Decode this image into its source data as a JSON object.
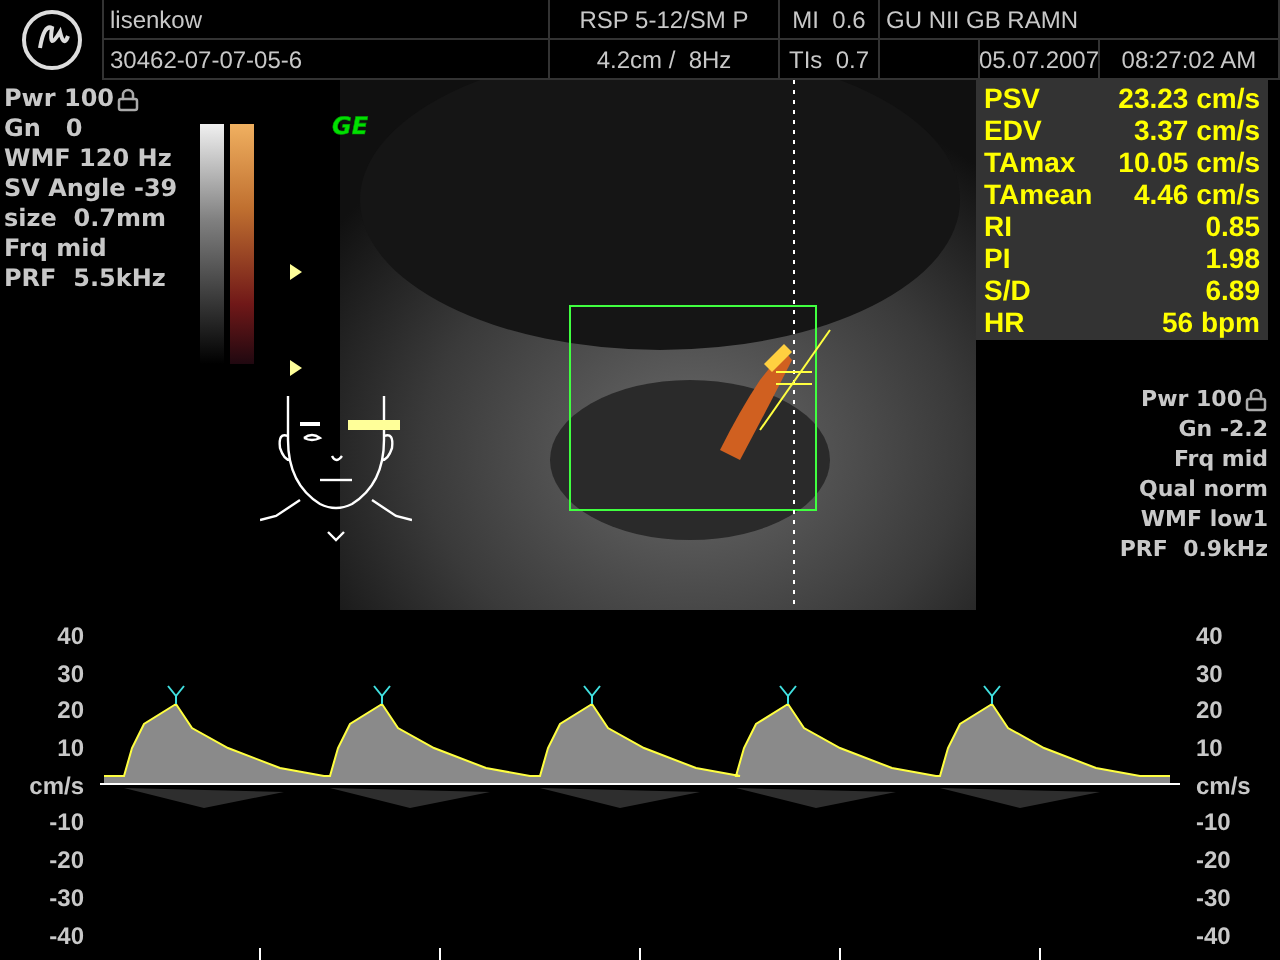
{
  "header": {
    "patient_name": "lisenkow",
    "patient_id": "30462-07-07-05-6",
    "probe": "RSP 5-12/SM P",
    "depth_frequency": "4.2cm /  8Hz",
    "mi": "MI  0.6",
    "tis": "TIs  0.7",
    "institution": "GU NII GB RAMN",
    "date": "05.07.2007",
    "time": "08:27:02 AM"
  },
  "doppler_params": [
    {
      "text": "Pwr 100",
      "locked": true
    },
    {
      "text": "Gn   0",
      "locked": false
    },
    {
      "text": "WMF 120 Hz",
      "locked": false
    },
    {
      "text": "SV Angle -39",
      "locked": false
    },
    {
      "text": "size  0.7mm",
      "locked": false
    },
    {
      "text": "Frq mid",
      "locked": false
    },
    {
      "text": "PRF  5.5kHz",
      "locked": false
    }
  ],
  "image_label": "GE",
  "measurements": [
    {
      "label": "PSV",
      "value": "23.23 cm/s"
    },
    {
      "label": "EDV",
      "value": "3.37 cm/s"
    },
    {
      "label": "TAmax",
      "value": "10.05 cm/s"
    },
    {
      "label": "TAmean",
      "value": "4.46 cm/s"
    },
    {
      "label": "RI",
      "value": "0.85"
    },
    {
      "label": "PI",
      "value": "1.98"
    },
    {
      "label": "S/D",
      "value": "6.89"
    },
    {
      "label": "HR",
      "value": "56 bpm"
    }
  ],
  "color_params": [
    {
      "text": "Pwr 100",
      "locked": true
    },
    {
      "text": "Gn -2.2",
      "locked": false
    },
    {
      "text": "Frq mid",
      "locked": false
    },
    {
      "text": "Qual norm",
      "locked": false
    },
    {
      "text": "WMF low1",
      "locked": false
    },
    {
      "text": "PRF  0.9kHz",
      "locked": false
    }
  ],
  "spectrum": {
    "left_axis": [
      "40",
      "30",
      "20",
      "10",
      "cm/s",
      "-10",
      "-20",
      "-30",
      "-40"
    ],
    "right_axis": [
      "40",
      "30",
      "20",
      "10",
      "cm/s",
      "-10",
      "-20",
      "-30",
      "-40"
    ]
  }
}
